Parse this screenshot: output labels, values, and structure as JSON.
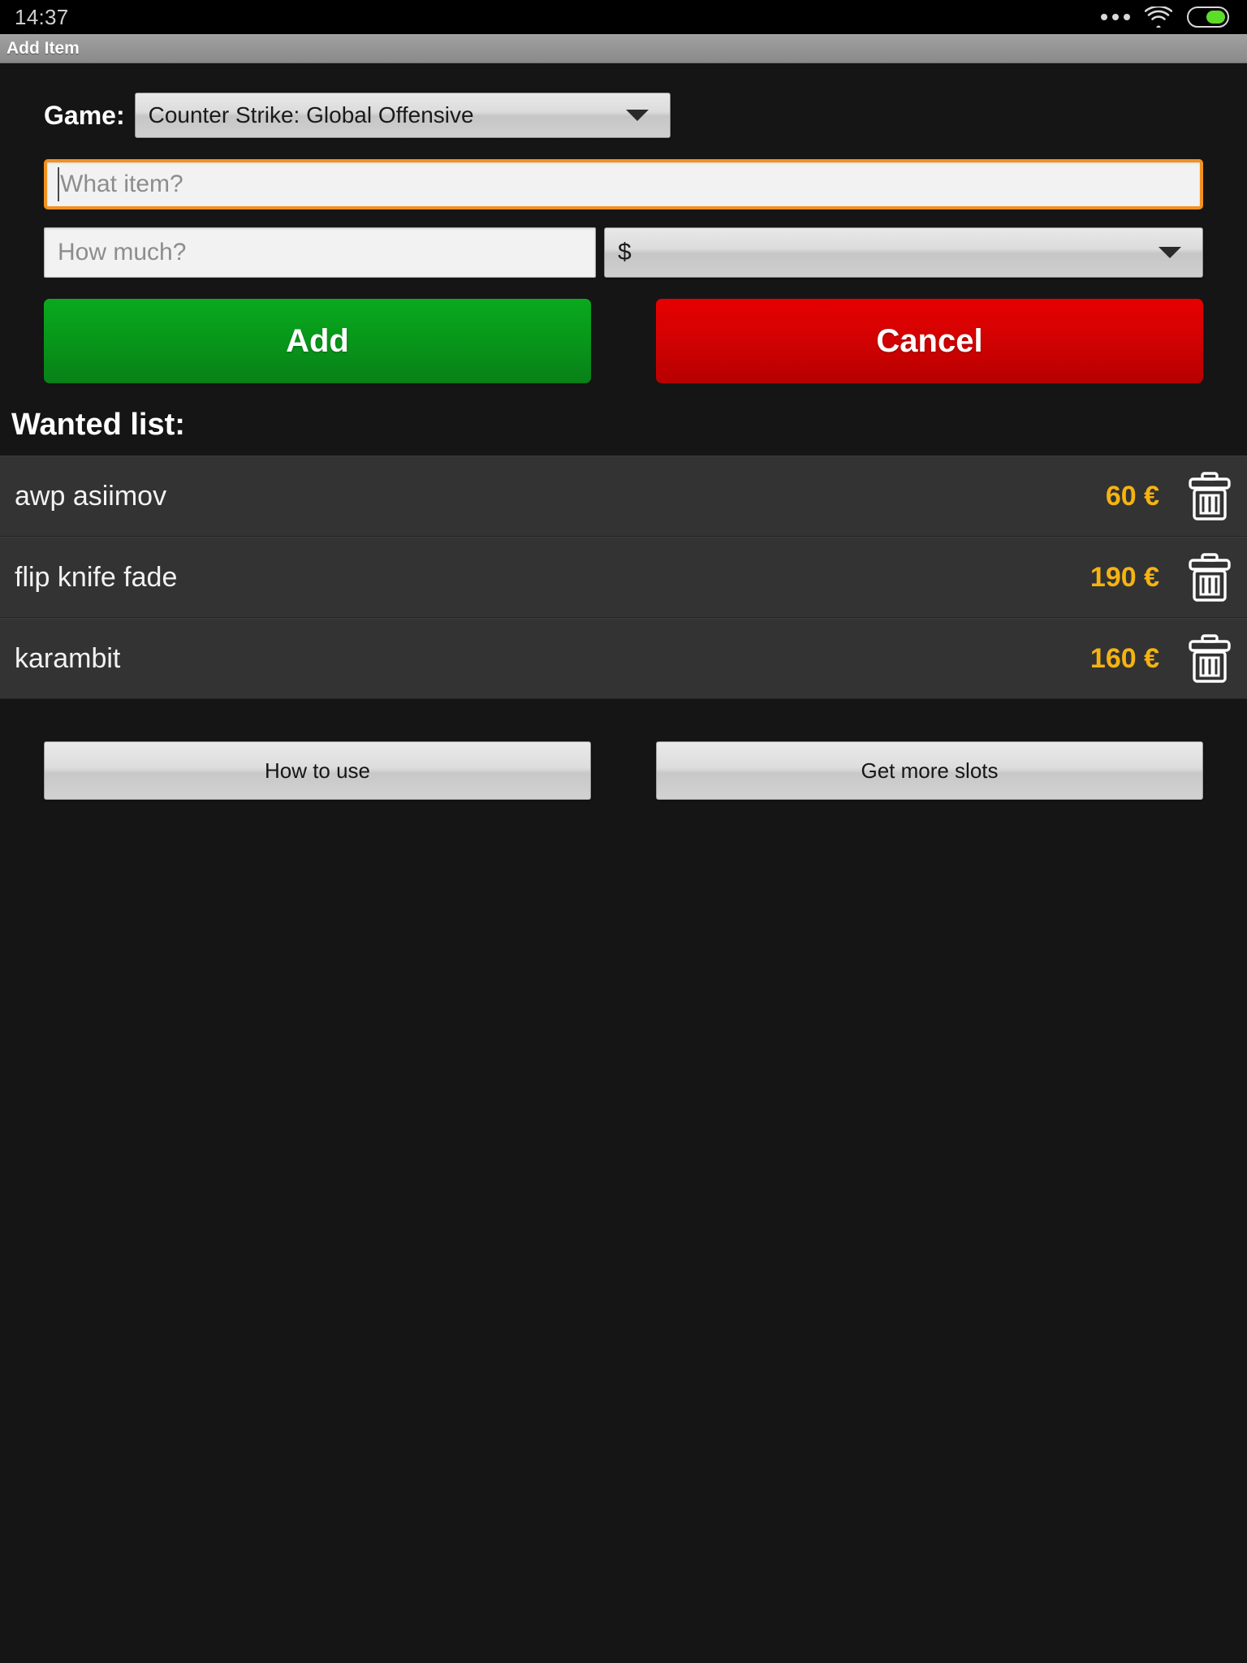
{
  "status_bar": {
    "clock": "14:37",
    "icons": [
      "more-dots-icon",
      "wifi-icon",
      "battery-icon"
    ],
    "battery_level_percent": 54
  },
  "title_bar": {
    "title": "Add Item"
  },
  "form": {
    "game_label": "Game:",
    "game_selected": "Counter Strike: Global Offensive",
    "item_placeholder": "What item?",
    "item_value": "",
    "price_placeholder": "How much?",
    "price_value": "",
    "currency_selected": "$",
    "add_label": "Add",
    "cancel_label": "Cancel"
  },
  "wanted": {
    "heading": "Wanted list:",
    "rows": [
      {
        "name": "awp asiimov",
        "price": "60 €",
        "delete_icon": "trash-icon"
      },
      {
        "name": "flip knife fade",
        "price": "190 €",
        "delete_icon": "trash-icon"
      },
      {
        "name": "karambit",
        "price": "160 €",
        "delete_icon": "trash-icon"
      }
    ]
  },
  "footer": {
    "how_to_use_label": "How to use",
    "get_more_slots_label": "Get more slots"
  },
  "colors": {
    "accent_focus": "#f29020",
    "price_text": "#f5b312",
    "add_button": "#07991a",
    "cancel_button": "#d40202",
    "battery_fill": "#5ddc28",
    "page_background": "#151515",
    "list_row_background": "#333333"
  }
}
